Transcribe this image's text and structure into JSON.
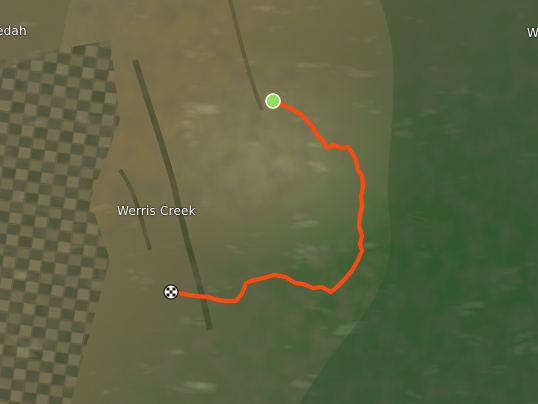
{
  "map": {
    "view": "satellite",
    "place_labels": {
      "werris_creek": "Werris Creek",
      "gunnedah_partial": "edah",
      "east_partial": "W"
    },
    "route": {
      "color": "#ff4a14",
      "start_marker_color": "#8ee05a",
      "finish_marker": "checkered-flag"
    }
  }
}
